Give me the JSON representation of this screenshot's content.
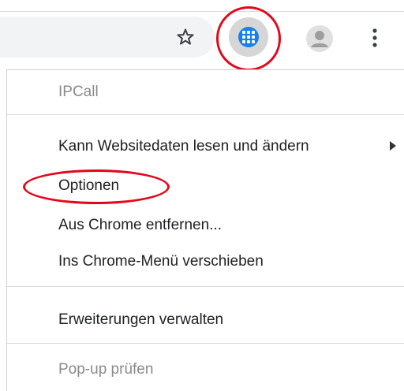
{
  "toolbar": {
    "bookmark_icon": "star-icon",
    "extension_icon": "ipcall-dialpad-icon",
    "avatar_icon": "profile-avatar-icon",
    "menu_icon": "vertical-dots-icon"
  },
  "menu": {
    "extension_name": "IPCall",
    "site_access": "Kann Websitedaten lesen und ändern",
    "options": "Optionen",
    "remove": "Aus Chrome entfernen...",
    "move_to_menu": "Ins Chrome-Menü verschieben",
    "manage_extensions": "Erweiterungen verwalten",
    "inspect_popup": "Pop-up prüfen"
  },
  "colors": {
    "highlight_ring": "#e3071b",
    "extension_badge": "#1a7fe6",
    "extension_button_bg": "#d6d6d6"
  }
}
